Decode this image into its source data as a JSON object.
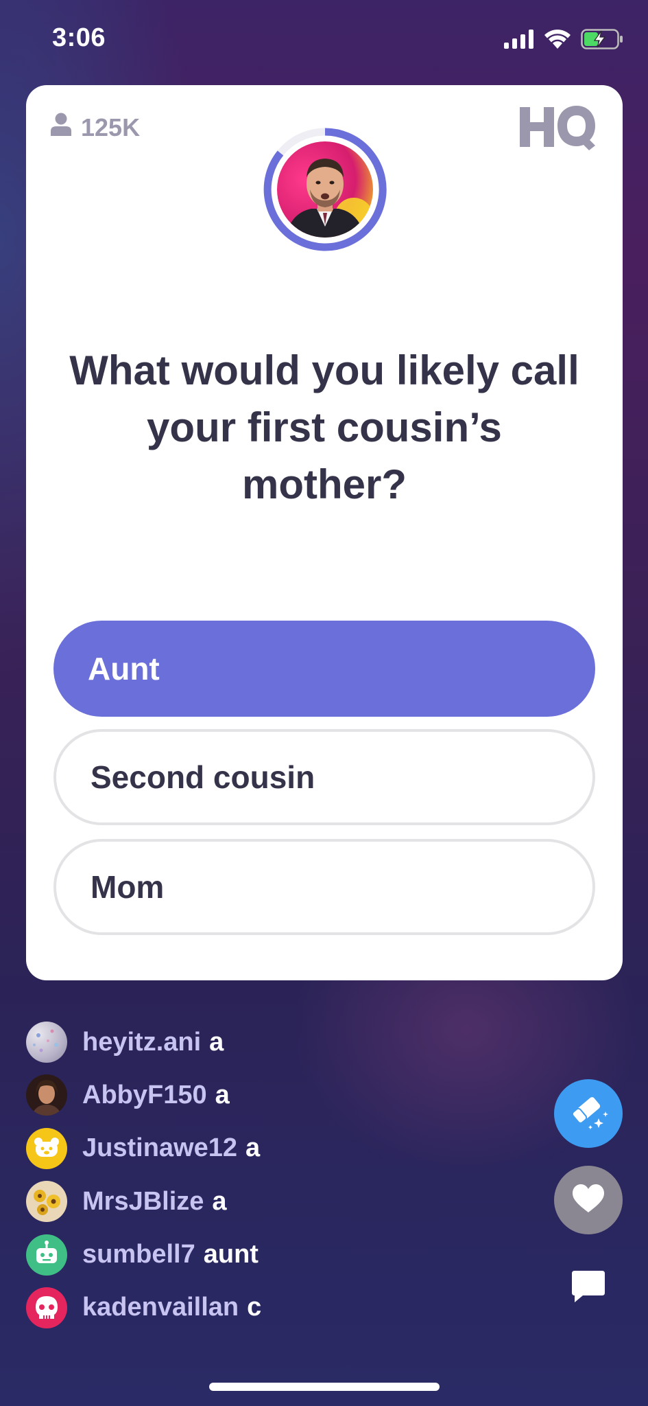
{
  "status_bar": {
    "time": "3:06"
  },
  "card": {
    "viewer_count": "125K",
    "logo_text": "HQ",
    "question": "What would you likely call your first cousin’s mother?",
    "answers": [
      {
        "label": "Aunt",
        "selected": true
      },
      {
        "label": "Second cousin",
        "selected": false
      },
      {
        "label": "Mom",
        "selected": false
      }
    ]
  },
  "chat": {
    "messages": [
      {
        "user": "heyitz.ani",
        "text": "a"
      },
      {
        "user": "AbbyF150",
        "text": "a"
      },
      {
        "user": "Justinawe12",
        "text": "a"
      },
      {
        "user": "MrsJBlize",
        "text": "a"
      },
      {
        "user": "sumbell7",
        "text": "aunt"
      },
      {
        "user": "kadenvaillan",
        "text": "c"
      }
    ]
  },
  "colors": {
    "accent": "#6b6fd9",
    "eraser_button": "#3d9cf2",
    "heart_button": "#8a8792",
    "question_text": "#35334a",
    "chat_username": "#c8c4f1"
  },
  "icons": {
    "status": [
      "cellular-signal-icon",
      "wifi-icon",
      "battery-charging-icon"
    ],
    "card": [
      "person-icon",
      "hq-logo-icon"
    ],
    "actions": [
      "eraser-icon",
      "heart-icon",
      "chat-bubble-icon"
    ]
  }
}
